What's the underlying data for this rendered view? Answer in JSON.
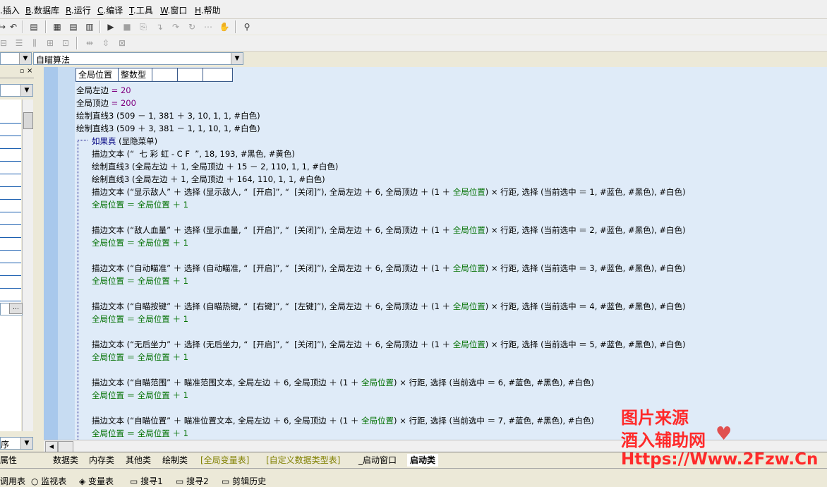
{
  "menu": [
    {
      "key": "",
      "label": "插入",
      "prefix": "插入"
    },
    {
      "key": "B",
      "label": ".数据库"
    },
    {
      "key": "R",
      "label": ".运行"
    },
    {
      "key": "C",
      "label": ".编译"
    },
    {
      "key": "T",
      "label": ".工具"
    },
    {
      "key": "W",
      "label": ".窗口"
    },
    {
      "key": "H",
      "label": ".帮助"
    }
  ],
  "combo": {
    "left_value": "",
    "right_value": "自瞄算法"
  },
  "left_panel": {
    "bottom_label": "序",
    "tab_label": "属性"
  },
  "table_header": [
    "全局位置",
    "整数型",
    "",
    "",
    ""
  ],
  "code": {
    "l1": {
      "a": "全局左边",
      "op": " = ",
      "v": "20"
    },
    "l2": {
      "a": "全局顶边",
      "op": " = ",
      "v": "200"
    },
    "l3": "绘制直线3 (509 － 1, 381 ＋ 3, 10, 1, 1, #白色)",
    "l4": "绘制直线3 (509 ＋ 3, 381 － 1, 1, 10, 1, #白色)",
    "if_kw": "如果真",
    "if_cond": " (显隐菜单)",
    "d1": "描边文本 (“  七 彩 虹 - C F  ”, 18, 193, #黑色, #黄色)",
    "d2": "绘制直线3 (全局左边 ＋ 1, 全局顶边 ＋ 15 － 2, 110, 1, 1, #白色)",
    "d3": "绘制直线3 (全局左边 ＋ 1, 全局顶边 ＋ 164, 110, 1, 1, #白色)",
    "items": [
      {
        "pre": "描边文本 (“显示敌人” ＋ 选择 (显示敌人, “  [开启]”, “  [关闭]”), 全局左边 ＋ 6, 全局顶边 ＋ (1 ＋ ",
        "post": ") × 行距, 选择 (当前选中 ＝ 1, #蓝色, #黑色), #白色)"
      },
      {
        "pre": "描边文本 (“敌人血量” ＋ 选择 (显示血量, “  [开启]”, “  [关闭]”), 全局左边 ＋ 6, 全局顶边 ＋ (1 ＋ ",
        "post": ") × 行距, 选择 (当前选中 ＝ 2, #蓝色, #黑色), #白色)"
      },
      {
        "pre": "描边文本 (“自动瞄准” ＋ 选择 (自动瞄准, “  [开启]”, “  [关闭]”), 全局左边 ＋ 6, 全局顶边 ＋ (1 ＋ ",
        "post": ") × 行距, 选择 (当前选中 ＝ 3, #蓝色, #黑色), #白色)"
      },
      {
        "pre": "描边文本 (“自瞄按键” ＋ 选择 (自瞄热键, “  [右键]”, “  [左键]”), 全局左边 ＋ 6, 全局顶边 ＋ (1 ＋ ",
        "post": ") × 行距, 选择 (当前选中 ＝ 4, #蓝色, #黑色), #白色)"
      },
      {
        "pre": "描边文本 (“无后坐力” ＋ 选择 (无后坐力, “  [开启]”, “  [关闭]”), 全局左边 ＋ 6, 全局顶边 ＋ (1 ＋ ",
        "post": ") × 行距, 选择 (当前选中 ＝ 5, #蓝色, #黑色), #白色)"
      },
      {
        "pre": "描边文本 (“自瞄范围” ＋ 瞄准范围文本, 全局左边 ＋ 6, 全局顶边 ＋ (1 ＋ ",
        "post": ") × 行距, 选择 (当前选中 ＝ 6, #蓝色, #黑色), #白色)"
      },
      {
        "pre": "描边文本 (“自瞄位置” ＋ 瞄准位置文本, 全局左边 ＋ 6, 全局顶边 ＋ (1 ＋ ",
        "post": ") × 行距, 选择 (当前选中 ＝ 7, #蓝色, #黑色), #白色)"
      }
    ],
    "var": "全局位置",
    "incr": "全局位置 ＝ 全局位置 ＋ 1"
  },
  "tabs": [
    "数据类",
    "内存类",
    "其他类",
    "绘制类",
    "[全局变量表]",
    "[自定义数据类型表]",
    "_启动窗口",
    "启动类"
  ],
  "status": [
    "调用表",
    "监视表",
    "变量表",
    "搜寻1",
    "搜寻2",
    "剪辑历史"
  ],
  "watermark": {
    "line1": "图片来源",
    "line2": "酒入辅助网",
    "line3": "Https://Www.2Fzw.Cn"
  },
  "colors": {
    "editor_bg": "#dfebf8",
    "green": "#007000",
    "purple": "#800080",
    "watermark": "#ff2a2a"
  }
}
